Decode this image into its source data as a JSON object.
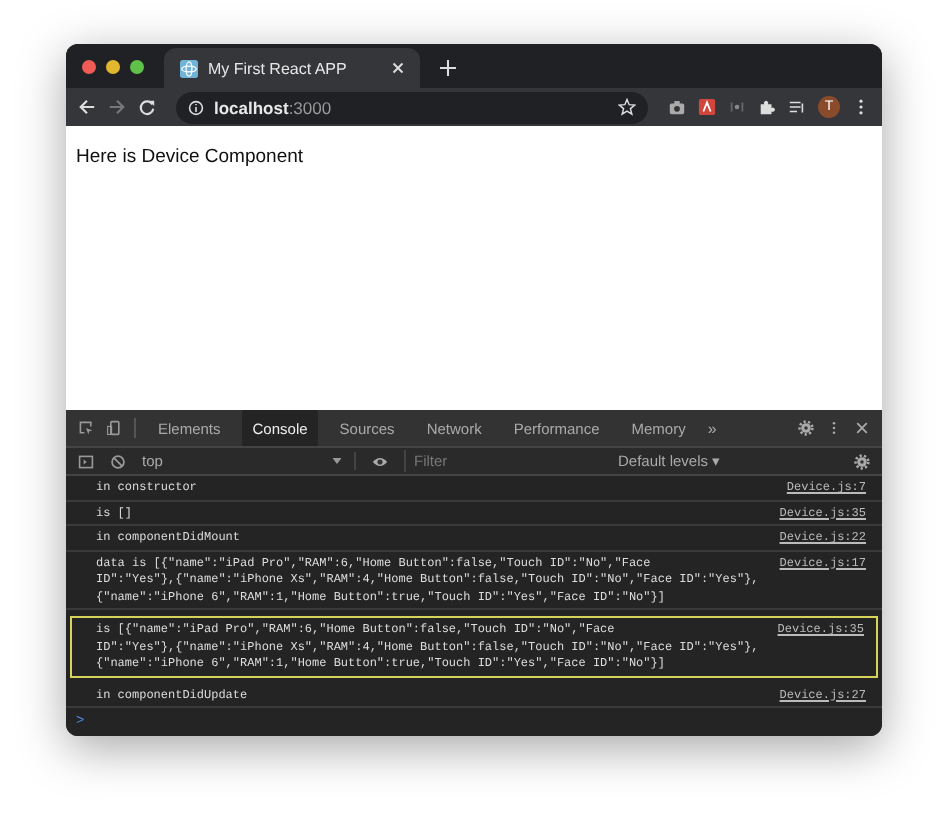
{
  "browser": {
    "tab": {
      "title": "My First React APP"
    },
    "address": {
      "host": "localhost",
      "port": ":3000"
    },
    "profile": "T"
  },
  "page": {
    "text": "Here is Device Component"
  },
  "devtools": {
    "tabs": [
      {
        "label": "Elements",
        "selected": false
      },
      {
        "label": "Console",
        "selected": true
      },
      {
        "label": "Sources",
        "selected": false
      },
      {
        "label": "Network",
        "selected": false
      },
      {
        "label": "Performance",
        "selected": false
      },
      {
        "label": "Memory",
        "selected": false
      }
    ],
    "more": "»",
    "context": "top",
    "filter": {
      "placeholder": "Filter"
    },
    "levels": "Default levels ▾",
    "messages": [
      {
        "lines": [
          "in constructor"
        ],
        "source": "Device.js:7",
        "highlighted": false
      },
      {
        "lines": [
          "is []"
        ],
        "source": "Device.js:35",
        "highlighted": false
      },
      {
        "lines": [
          "in componentDidMount"
        ],
        "source": "Device.js:22",
        "highlighted": false
      },
      {
        "lines": [
          "data is [{\"name\":\"iPad Pro\",\"RAM\":6,\"Home Button\":false,\"Touch ID\":\"No\",\"Face",
          "ID\":\"Yes\"},{\"name\":\"iPhone Xs\",\"RAM\":4,\"Home Button\":false,\"Touch ID\":\"No\",\"Face ID\":\"Yes\"},",
          "{\"name\":\"iPhone 6\",\"RAM\":1,\"Home Button\":true,\"Touch ID\":\"Yes\",\"Face ID\":\"No\"}]"
        ],
        "source": "Device.js:17",
        "highlighted": false
      },
      {
        "lines": [
          "is [{\"name\":\"iPad Pro\",\"RAM\":6,\"Home Button\":false,\"Touch ID\":\"No\",\"Face",
          "ID\":\"Yes\"},{\"name\":\"iPhone Xs\",\"RAM\":4,\"Home Button\":false,\"Touch ID\":\"No\",\"Face ID\":\"Yes\"},",
          "{\"name\":\"iPhone 6\",\"RAM\":1,\"Home Button\":true,\"Touch ID\":\"Yes\",\"Face ID\":\"No\"}]"
        ],
        "source": "Device.js:35",
        "highlighted": true
      },
      {
        "lines": [
          "in componentDidUpdate"
        ],
        "source": "Device.js:27",
        "highlighted": false
      }
    ],
    "prompt": ">"
  }
}
